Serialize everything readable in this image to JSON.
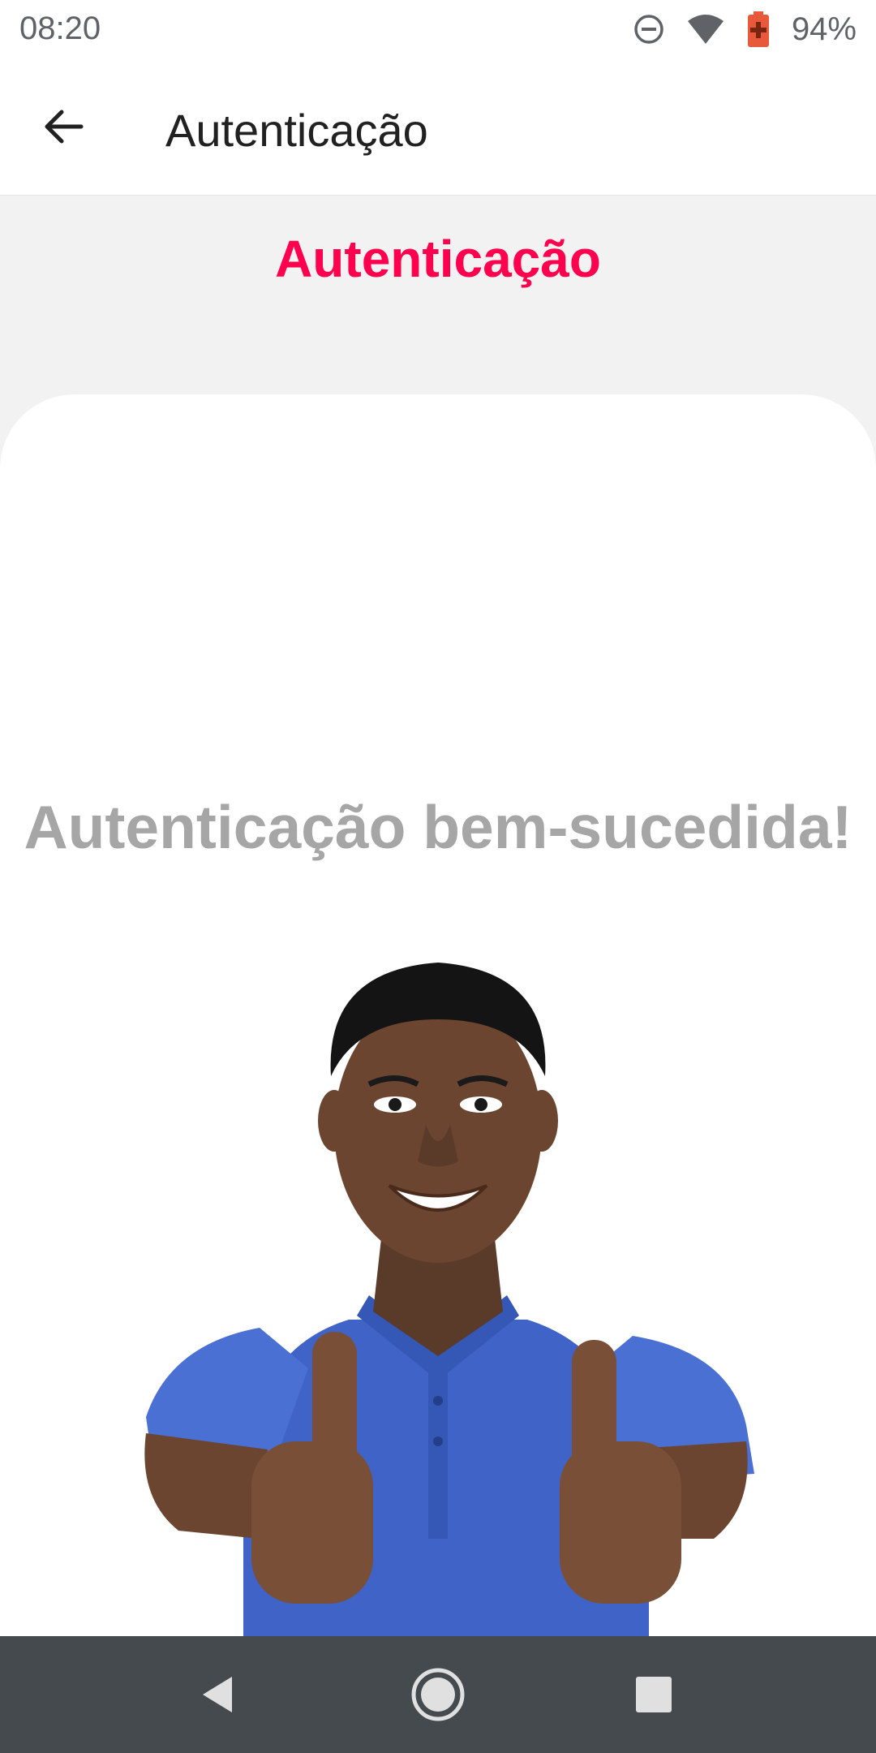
{
  "status_bar": {
    "time": "08:20",
    "battery_percent": "94%",
    "icons": [
      "do-not-disturb-icon",
      "wifi-icon",
      "battery-icon"
    ]
  },
  "app_bar": {
    "title": "Autenticação",
    "back_icon": "arrow-back-icon"
  },
  "header": {
    "title": "Autenticação"
  },
  "content": {
    "message": "Autenticação bem-sucedida!",
    "image": "smiling-man-thumbs-up-photo"
  },
  "nav_bar": {
    "icons": [
      "nav-back-icon",
      "nav-home-icon",
      "nav-recents-icon"
    ]
  },
  "colors": {
    "accent": "#ff004f",
    "message_text": "#a6a6a6",
    "shirt": "#3f63c7",
    "skin": "#6b4530",
    "nav_bar": "#454a4f"
  }
}
